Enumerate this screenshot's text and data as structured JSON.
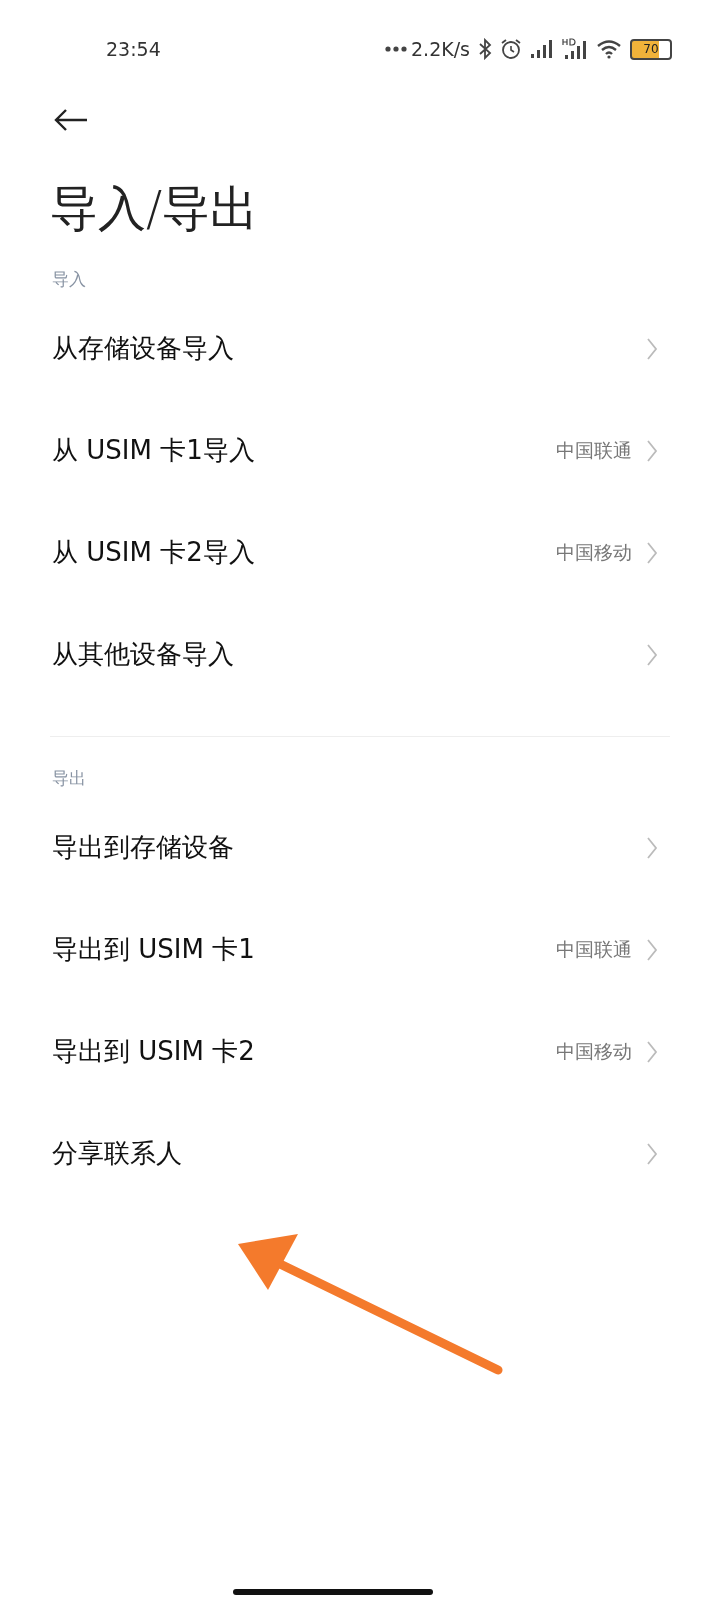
{
  "status_bar": {
    "time": "23:54",
    "network_speed": "2.2K/s",
    "battery": "70"
  },
  "title": "导入/导出",
  "sections": [
    {
      "label": "导入",
      "items": [
        {
          "label": "从存储设备导入"
        },
        {
          "label": "从 USIM 卡1导入",
          "value": "中国联通"
        },
        {
          "label": "从 USIM 卡2导入",
          "value": "中国移动"
        },
        {
          "label": "从其他设备导入"
        }
      ]
    },
    {
      "label": "导出",
      "items": [
        {
          "label": "导出到存储设备"
        },
        {
          "label": "导出到 USIM 卡1",
          "value": "中国联通"
        },
        {
          "label": "导出到 USIM 卡2",
          "value": "中国移动"
        },
        {
          "label": "分享联系人"
        }
      ]
    }
  ]
}
